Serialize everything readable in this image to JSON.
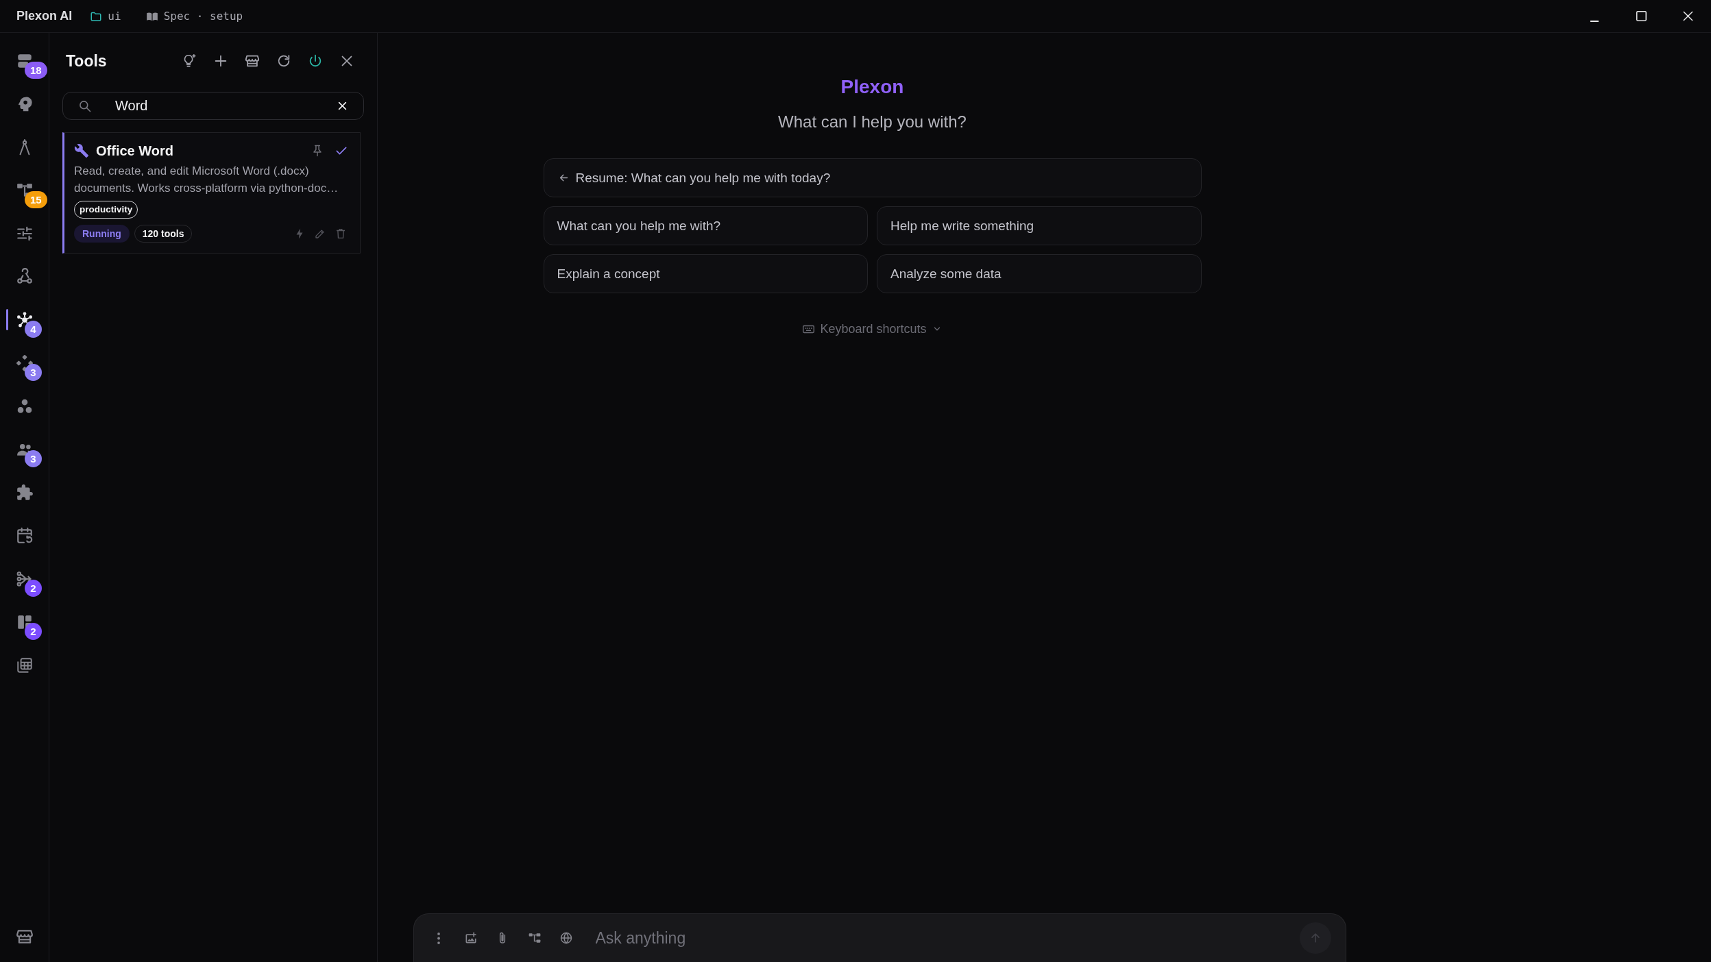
{
  "titlebar": {
    "app_name": "Plexon AI",
    "crumbs": [
      {
        "kind": "folder",
        "label": "ui"
      },
      {
        "kind": "book",
        "label": "Spec · setup"
      }
    ]
  },
  "rail": {
    "items": [
      {
        "selected": false,
        "badge": {
          "text": "18",
          "color": "#8b5cf6"
        }
      },
      {
        "selected": false
      },
      {
        "selected": false
      },
      {
        "selected": false,
        "badge": {
          "text": "15",
          "color": "#f59e0b"
        }
      },
      {
        "selected": false
      },
      {
        "selected": false
      },
      {
        "selected": true,
        "badge": {
          "text": "4",
          "color": "#8b7cf0"
        }
      },
      {
        "selected": false,
        "badge": {
          "text": "3",
          "color": "#8b7cf0"
        }
      },
      {
        "selected": false
      },
      {
        "selected": false,
        "badge": {
          "text": "3",
          "color": "#8b7cf0"
        }
      },
      {
        "selected": false
      },
      {
        "selected": false
      },
      {
        "selected": false,
        "badge": {
          "text": "2",
          "color": "#7c4dff"
        }
      },
      {
        "selected": false,
        "badge": {
          "text": "2",
          "color": "#7c4dff"
        }
      },
      {
        "selected": false
      }
    ]
  },
  "tools_panel": {
    "title": "Tools",
    "search": {
      "value": "Word"
    },
    "servers": [
      {
        "name": "Office Word",
        "description": "Read, create, and edit Microsoft Word (.docx) documents. Works cross-platform via python-doc…",
        "selected": true,
        "checked": true,
        "tags": [
          "productivity"
        ],
        "status": "Running",
        "tool_count": "120 tools"
      }
    ]
  },
  "home": {
    "brand": "Plexon",
    "prompt": "What can I help you with?",
    "resume": "Resume: What can you help me with today?",
    "suggestions": [
      "What can you help me with?",
      "Help me write something",
      "Explain a concept",
      "Analyze some data"
    ],
    "shortcuts": {
      "label": "Keyboard shortcuts",
      "expanded": false
    }
  },
  "composer": {
    "placeholder": "Ask anything",
    "send_button": {
      "disabled": true
    }
  }
}
